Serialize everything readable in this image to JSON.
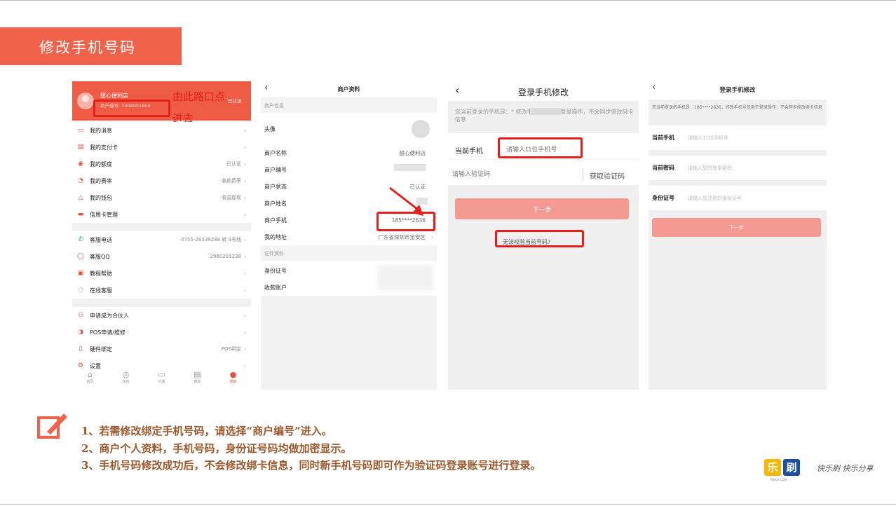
{
  "banner": {
    "title": "修改手机号码"
  },
  "panel1": {
    "shop_name": "甜心便利店",
    "merchant_no": "商户编号: 1408001804",
    "verified": "已认证",
    "annotation_line1": "由此路口点",
    "annotation_line2": "进去",
    "menu": [
      {
        "label": "我的消息",
        "value": "",
        "icon": "message-icon"
      },
      {
        "label": "我的支付卡",
        "value": "",
        "icon": "card-icon"
      },
      {
        "label": "我的额度",
        "value": "已认证",
        "icon": "quota-icon"
      },
      {
        "label": "我的费率",
        "value": "收款费率",
        "icon": "rate-icon"
      },
      {
        "label": "我的钱包",
        "value": "收益提现",
        "icon": "wallet-icon"
      },
      {
        "label": "信用卡管理",
        "value": "",
        "icon": "credit-card-icon"
      },
      {
        "label": "客服电话",
        "value": "0755-26339288 转 3号线",
        "icon": "phone-icon"
      },
      {
        "label": "客服QQ",
        "value": "2980291238",
        "icon": "qq-icon"
      },
      {
        "label": "教程帮助",
        "value": "",
        "icon": "help-icon"
      },
      {
        "label": "在线客服",
        "value": "",
        "icon": "chat-icon"
      },
      {
        "label": "申请成为合伙人",
        "value": "",
        "icon": "partner-icon"
      },
      {
        "label": "POS申请/维修",
        "value": "",
        "icon": "pos-icon"
      },
      {
        "label": "硬件绑定",
        "value": "POS绑定",
        "icon": "hardware-icon"
      },
      {
        "label": "设置",
        "value": "",
        "icon": "settings-icon"
      }
    ],
    "tabs": [
      "首页",
      "钱包",
      "乐播",
      "推单",
      "我的"
    ]
  },
  "panel2": {
    "title": "商户资料",
    "section_info": "商户信息",
    "avatar_label": "头像",
    "rows": [
      {
        "label": "商户名称",
        "value": "甜心便利店"
      },
      {
        "label": "商户编号",
        "value": ""
      },
      {
        "label": "商户状态",
        "value": "已认证"
      },
      {
        "label": "商户姓名",
        "value": ""
      },
      {
        "label": "商户手机",
        "value": "185****2636"
      },
      {
        "label": "我的地址",
        "value": "广东省深圳市宝安区"
      }
    ],
    "section_cert": "证件资料",
    "rows2": [
      {
        "label": "身份证号",
        "value": ""
      },
      {
        "label": "收款账户",
        "value": ""
      }
    ]
  },
  "panel3": {
    "title": "登录手机修改",
    "notice": "您当前登录的手机是：*               修改手机号仅限于登录操作，不会同步修改绑卡信息",
    "phone_label": "当前手机",
    "phone_placeholder": "请输入11位手机号",
    "code_placeholder": "请输入验证码",
    "get_code": "获取验证码",
    "next": "下一步",
    "cannot_verify": "无法校验当前号码?"
  },
  "panel4": {
    "title": "登录手机修改",
    "notice": "您当前登录的手机是：185****2636，修改手机号仅用于登录操作，不会同步修改绑卡信息",
    "fields": [
      {
        "label": "当前手机",
        "placeholder": "请输入11位手机号"
      },
      {
        "label": "当前密码",
        "placeholder": "请输入您的登录密码"
      },
      {
        "label": "身份证号",
        "placeholder": "请输入您注册的身份证号"
      }
    ],
    "next": "下一步"
  },
  "notes": [
    "1、若需修改绑定手机号码，请选择“商户编号”进入。",
    "2、商户个人资料，手机号码，身份证号码均做加密显示。",
    "3、手机号码修改成功后，不会修改绑卡信息，同时新手机号码即可作为验证码登录账号进行登录。"
  ],
  "logo": {
    "part1": "乐",
    "part2": "刷",
    "sub": "YSHUA.COM"
  },
  "signature": "快乐刷 快乐分享",
  "colors": {
    "accent": "#f0634a",
    "note_text": "#9a5a2e",
    "highlight": "#e3201c",
    "button": "#f59a92"
  }
}
